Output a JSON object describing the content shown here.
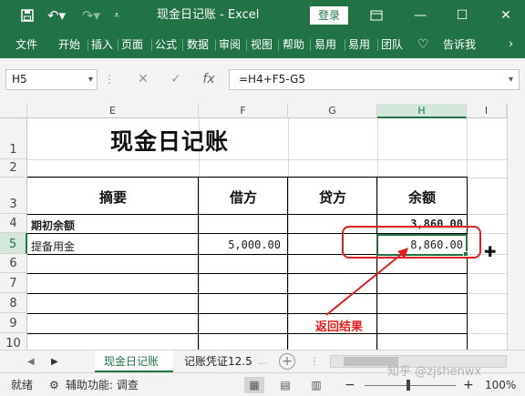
{
  "titlebar": {
    "save_icon": "save-icon",
    "undo_icon": "undo-icon",
    "redo_icon": "redo-icon",
    "title": "现金日记账  -  Excel",
    "login": "登录",
    "accent": "#217346"
  },
  "ribbon": {
    "tabs": [
      "文件",
      "开始",
      "插入",
      "页面",
      "公式",
      "数据",
      "审阅",
      "视图",
      "帮助",
      "易用",
      "易用",
      "团队",
      "告诉我"
    ]
  },
  "formula_bar": {
    "name_box": "H5",
    "formula": "=H4+F5-G5",
    "fx": "fx"
  },
  "grid": {
    "columns": [
      "E",
      "F",
      "G",
      "H",
      "I"
    ],
    "active_column": "H",
    "rows": [
      "1",
      "2",
      "3",
      "4",
      "5",
      "6",
      "7",
      "8",
      "9",
      "10"
    ],
    "active_row": "5",
    "title": "现金日记账",
    "headers": {
      "summary": "摘要",
      "debit": "借方",
      "credit": "贷方",
      "balance": "余额"
    },
    "row4": {
      "summary": "期初余额",
      "balance": "3,860.00"
    },
    "row5": {
      "summary": "提备用金",
      "debit": "5,000.00",
      "balance": "8,860.00"
    }
  },
  "annotation": {
    "text": "返回结果",
    "color": "#e02020"
  },
  "sheets": {
    "tabs": [
      "现金日记账",
      "记账凭证12.5"
    ],
    "active": "现金日记账"
  },
  "status": {
    "ready": "就绪",
    "accessibility": "辅助功能: 调查",
    "zoom": "100%",
    "watermark": "知乎 @zjshenwx"
  }
}
